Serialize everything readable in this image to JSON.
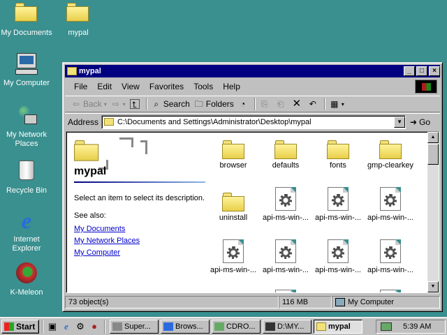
{
  "desktop": {
    "icons": [
      {
        "label": "My Documents",
        "icon": "my-documents-icon"
      },
      {
        "label": "mypal",
        "icon": "folder-icon"
      },
      {
        "label": "My Computer",
        "icon": "my-computer-icon"
      },
      {
        "label": "My Network Places",
        "icon": "network-places-icon"
      },
      {
        "label": "Recycle Bin",
        "icon": "recycle-bin-icon"
      },
      {
        "label": "Internet Explorer",
        "icon": "internet-explorer-icon"
      },
      {
        "label": "K-Meleon",
        "icon": "k-meleon-icon"
      }
    ]
  },
  "window": {
    "title": "mypal",
    "controls": {
      "minimize": "_",
      "maximize": "□",
      "close": "×"
    },
    "menu": [
      "File",
      "Edit",
      "View",
      "Favorites",
      "Tools",
      "Help"
    ],
    "toolbar": {
      "back": "Back",
      "search": "Search",
      "folders": "Folders"
    },
    "address": {
      "label": "Address",
      "value": "C:\\Documents and Settings\\Administrator\\Desktop\\mypal",
      "go": "Go"
    },
    "left_pane": {
      "title": "mypal",
      "description": "Select an item to select its description.",
      "see_also": "See also:",
      "links": [
        "My Documents",
        "My Network Places",
        "My Computer"
      ]
    },
    "items": [
      {
        "name": "browser",
        "type": "folder"
      },
      {
        "name": "defaults",
        "type": "folder"
      },
      {
        "name": "fonts",
        "type": "folder"
      },
      {
        "name": "gmp-clearkey",
        "type": "folder"
      },
      {
        "name": "uninstall",
        "type": "folder"
      },
      {
        "name": "api-ms-win-...",
        "type": "system-file"
      },
      {
        "name": "api-ms-win-...",
        "type": "system-file"
      },
      {
        "name": "api-ms-win-...",
        "type": "system-file"
      },
      {
        "name": "api-ms-win-...",
        "type": "system-file"
      },
      {
        "name": "api-ms-win-...",
        "type": "system-file"
      },
      {
        "name": "api-ms-win-...",
        "type": "system-file"
      },
      {
        "name": "api-ms-win-...",
        "type": "system-file"
      }
    ],
    "status": {
      "objects": "73 object(s)",
      "size": "116 MB",
      "zone": "My Computer"
    }
  },
  "taskbar": {
    "start": "Start",
    "tasks": [
      {
        "label": "Super...",
        "active": false
      },
      {
        "label": "Brows...",
        "active": false
      },
      {
        "label": "CDRO...",
        "active": false
      },
      {
        "label": "D:\\MY...",
        "active": false
      },
      {
        "label": "mypal",
        "active": true
      }
    ],
    "clock": "5:39 AM"
  }
}
